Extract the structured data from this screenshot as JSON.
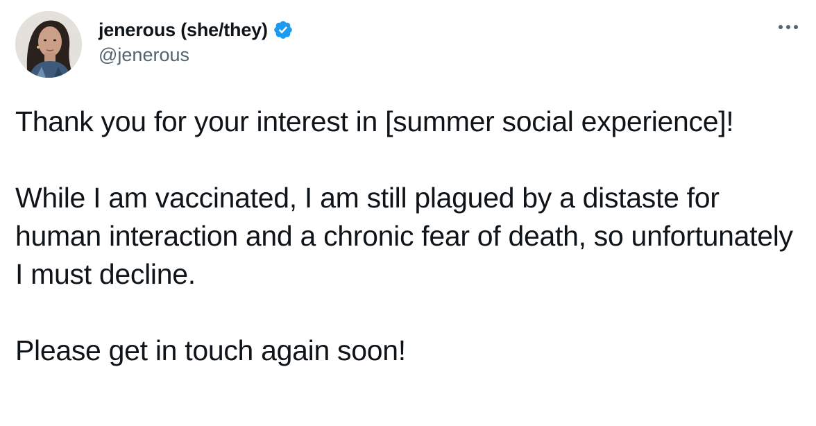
{
  "tweet": {
    "author": {
      "display_name": "jenerous (she/they)",
      "handle": "@jenerous",
      "verified": true,
      "avatar_icon": "profile-photo"
    },
    "more_icon": "more-options-icon",
    "paragraphs": [
      "Thank you for your interest in [summer social experience]!",
      "While I am vaccinated, I am still plagued by a distaste for human interaction and a chronic fear of death, so unfortunately I must decline.",
      "Please get in touch again soon!"
    ]
  },
  "colors": {
    "text_primary": "#0f1419",
    "text_secondary": "#536471",
    "verified_blue": "#1d9bf0",
    "background": "#ffffff"
  }
}
